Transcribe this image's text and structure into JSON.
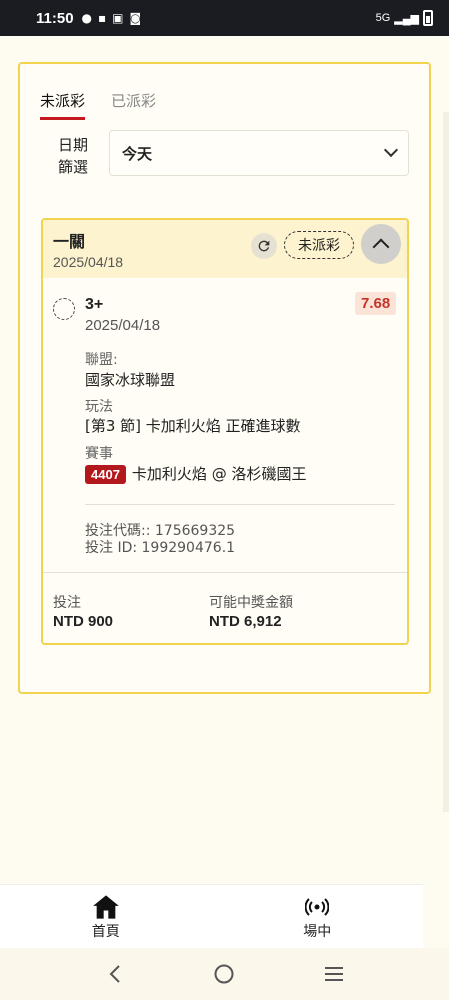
{
  "status_bar": {
    "time": "11:50",
    "network": "5G"
  },
  "tabs": [
    {
      "label": "未派彩",
      "active": true
    },
    {
      "label": "已派彩",
      "active": false
    }
  ],
  "filter": {
    "label": "日期篩選",
    "label_line1": "日期",
    "label_line2": "篩選",
    "value": "今天"
  },
  "bet": {
    "title": "一關",
    "date": "2025/04/18",
    "status": "未派彩",
    "selection": "3+",
    "selection_date": "2025/04/18",
    "odds": "7.68",
    "league_label": "聯盟:",
    "league": "國家冰球聯盟",
    "market_label": "玩法",
    "market": "[第3 節] 卡加利火焰 正確進球數",
    "event_label": "賽事",
    "event_id": "4407",
    "event_name": "卡加利火焰 @ 洛杉磯國王",
    "bet_code": "投注代碼:: 175669325",
    "bet_id": "投注 ID: 199290476.1",
    "stake_label": "投注",
    "stake": "NTD 900",
    "payout_label": "可能中獎金額",
    "payout": "NTD 6,912"
  },
  "nav": [
    {
      "label": "首頁",
      "icon": "home-icon"
    },
    {
      "label": "場中",
      "icon": "live-icon"
    }
  ],
  "colors": {
    "accent": "#c4191e",
    "border": "#f2d34e",
    "header_bg": "#fdf3cf"
  }
}
